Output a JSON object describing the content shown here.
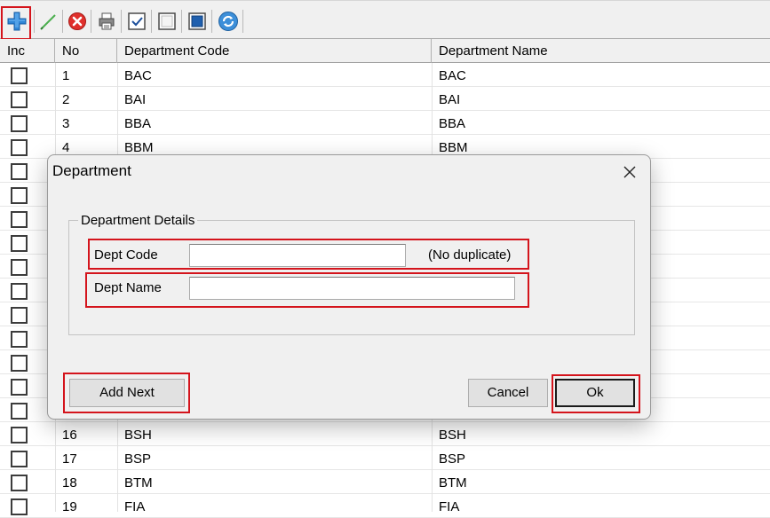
{
  "toolbar": {
    "icons": [
      "add-icon",
      "edit-icon",
      "delete-icon",
      "print-icon",
      "select-all-icon",
      "deselect-all-icon",
      "save-icon",
      "refresh-icon"
    ]
  },
  "grid": {
    "columns": [
      "Inc",
      "No",
      "Department Code",
      "Department Name"
    ],
    "rows": [
      {
        "no": "1",
        "code": "BAC",
        "name": "BAC"
      },
      {
        "no": "2",
        "code": "BAI",
        "name": "BAI"
      },
      {
        "no": "3",
        "code": "BBA",
        "name": "BBA"
      },
      {
        "no": "4",
        "code": "BBM",
        "name": "BBM"
      },
      {
        "no": "",
        "code": "",
        "name": ""
      },
      {
        "no": "",
        "code": "",
        "name": ""
      },
      {
        "no": "",
        "code": "",
        "name": ""
      },
      {
        "no": "",
        "code": "",
        "name": ""
      },
      {
        "no": "",
        "code": "",
        "name": ""
      },
      {
        "no": "",
        "code": "",
        "name": ""
      },
      {
        "no": "",
        "code": "",
        "name": ""
      },
      {
        "no": "",
        "code": "",
        "name": ""
      },
      {
        "no": "",
        "code": "",
        "name": ""
      },
      {
        "no": "",
        "code": "",
        "name": ""
      },
      {
        "no": "",
        "code": "",
        "name": ""
      },
      {
        "no": "16",
        "code": "BSH",
        "name": "BSH"
      },
      {
        "no": "17",
        "code": "BSP",
        "name": "BSP"
      },
      {
        "no": "18",
        "code": "BTM",
        "name": "BTM"
      },
      {
        "no": "19",
        "code": "FIA",
        "name": "FIA"
      }
    ]
  },
  "dialog": {
    "title": "Department",
    "group_label": "Department Details",
    "dept_code_label": "Dept Code",
    "dept_code_value": "",
    "dept_code_hint": "(No duplicate)",
    "dept_name_label": "Dept Name",
    "dept_name_value": "",
    "add_next_label": "Add Next",
    "cancel_label": "Cancel",
    "ok_label": "Ok"
  },
  "colors": {
    "highlight": "#d4141c",
    "dialog_bg": "#f0f0f0",
    "toolbar_bg": "#f0f0f0"
  }
}
